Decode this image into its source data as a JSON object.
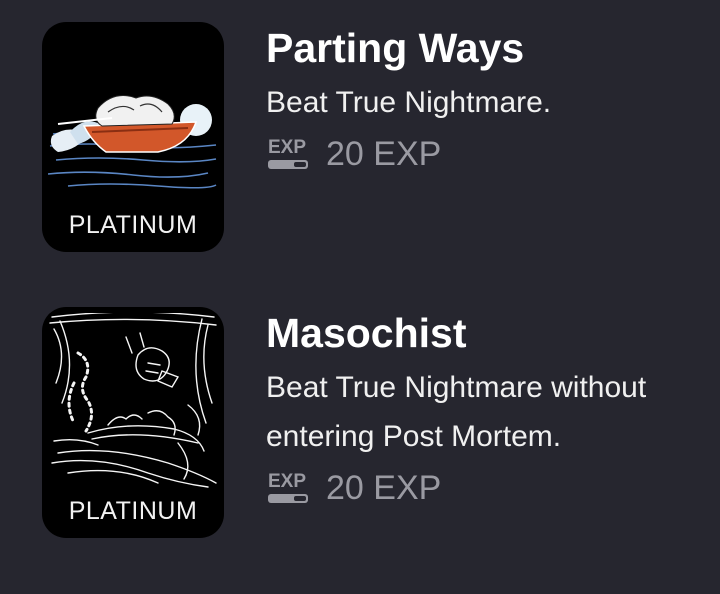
{
  "achievements": [
    {
      "title": "Parting Ways",
      "description": "Beat True Nightmare.",
      "tier": "PLATINUM",
      "exp": "20 EXP",
      "icon": "boat-art-icon"
    },
    {
      "title": "Masochist",
      "description": "Beat True Nightmare without entering Post Mortem.",
      "tier": "PLATINUM",
      "exp": "20 EXP",
      "icon": "sketch-art-icon"
    }
  ],
  "colors": {
    "background": "#26262f",
    "badge": "#000000",
    "exp_text": "#9a9aa2",
    "boat": "#d2572a"
  }
}
